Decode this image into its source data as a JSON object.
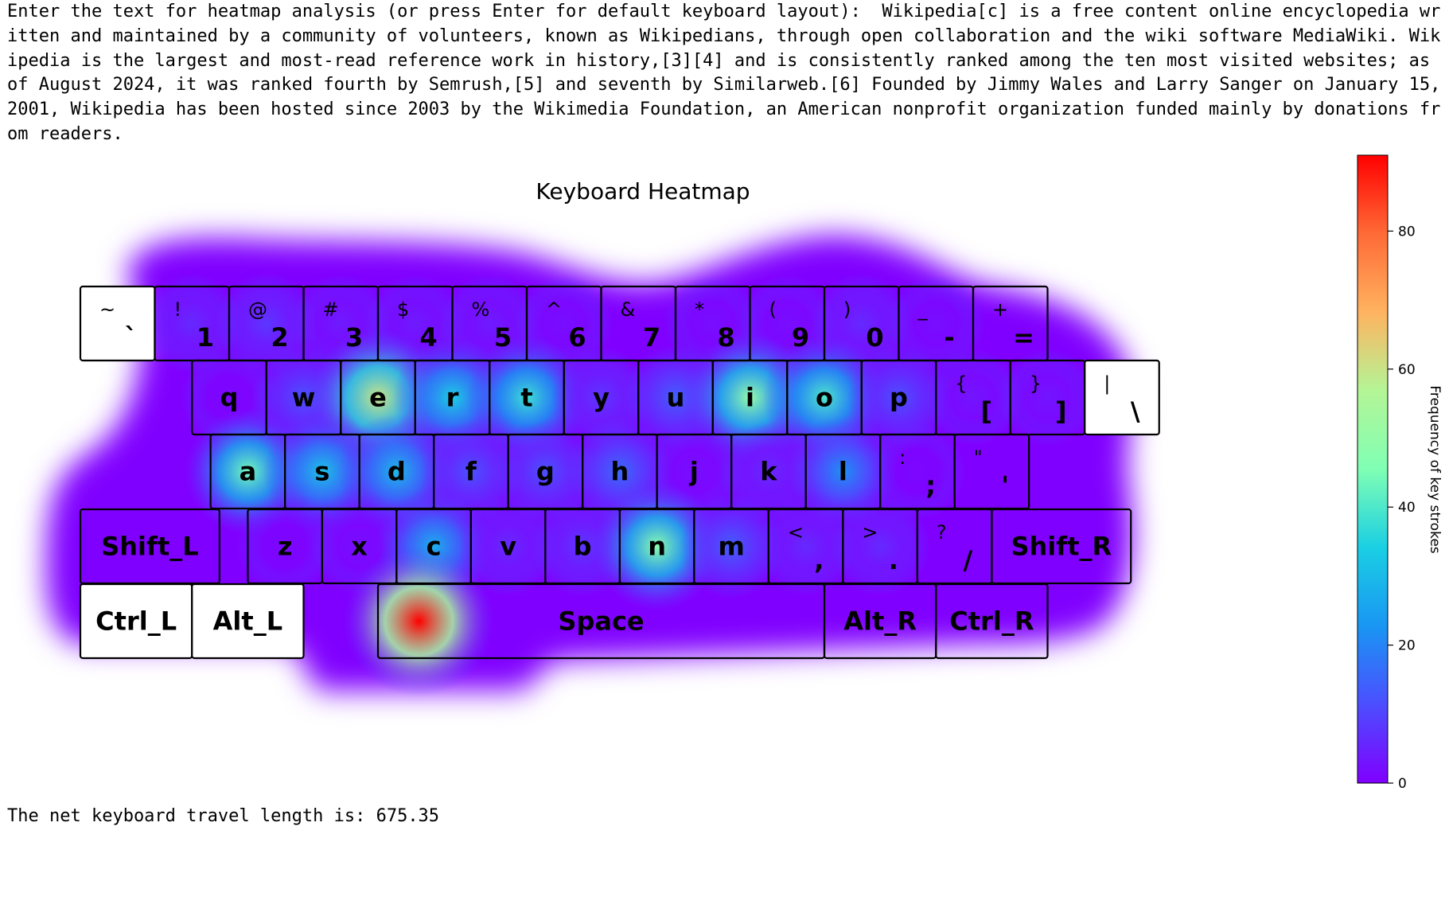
{
  "console": {
    "prompt_line": "Enter the text for heatmap analysis (or press Enter for default keyboard layout):  Wikipedia[c] is a free content online encyclopedia written and maintained by a community of volunteers, known as Wikipedians, through open collaboration and the wiki software MediaWiki. Wikipedia is the largest and most-read reference work in history,[3][4] and is consistently ranked among the ten most visited websites; as of August 2024, it was ranked fourth by Semrush,[5] and seventh by Similarweb.[6] Founded by Jimmy Wales and Larry Sanger on January 15, 2001, Wikipedia has been hosted since 2003 by the Wikimedia Foundation, an American nonprofit organization funded mainly by donations from readers.",
    "result_line": "The net keyboard travel length is: 675.35"
  },
  "chart_data": {
    "type": "heatmap",
    "title": "Keyboard Heatmap",
    "colorbar": {
      "label": "Frequency of key strokes",
      "ticks": [
        0,
        20,
        40,
        60,
        80
      ],
      "range": [
        0,
        91
      ],
      "colormap": "rainbow"
    },
    "keyboard_rows": [
      [
        {
          "top": "~",
          "bottom": "`"
        },
        {
          "top": "!",
          "bottom": "1"
        },
        {
          "top": "@",
          "bottom": "2"
        },
        {
          "top": "#",
          "bottom": "3"
        },
        {
          "top": "$",
          "bottom": "4"
        },
        {
          "top": "%",
          "bottom": "5"
        },
        {
          "top": "^",
          "bottom": "6"
        },
        {
          "top": "&",
          "bottom": "7"
        },
        {
          "top": "*",
          "bottom": "8"
        },
        {
          "top": "(",
          "bottom": "9"
        },
        {
          "top": ")",
          "bottom": "0"
        },
        {
          "top": "_",
          "bottom": "-"
        },
        {
          "top": "+",
          "bottom": "="
        }
      ],
      [
        {
          "label": "q"
        },
        {
          "label": "w"
        },
        {
          "label": "e"
        },
        {
          "label": "r"
        },
        {
          "label": "t"
        },
        {
          "label": "y"
        },
        {
          "label": "u"
        },
        {
          "label": "i"
        },
        {
          "label": "o"
        },
        {
          "label": "p"
        },
        {
          "top": "{",
          "bottom": "["
        },
        {
          "top": "}",
          "bottom": "]"
        },
        {
          "top": "|",
          "bottom": "\\"
        }
      ],
      [
        {
          "label": "a"
        },
        {
          "label": "s"
        },
        {
          "label": "d"
        },
        {
          "label": "f"
        },
        {
          "label": "g"
        },
        {
          "label": "h"
        },
        {
          "label": "j"
        },
        {
          "label": "k"
        },
        {
          "label": "l"
        },
        {
          "top": ":",
          "bottom": ";"
        },
        {
          "top": "\"",
          "bottom": "'"
        }
      ],
      [
        {
          "label": "Shift_L"
        },
        {
          "label": "z"
        },
        {
          "label": "x"
        },
        {
          "label": "c"
        },
        {
          "label": "v"
        },
        {
          "label": "b"
        },
        {
          "label": "n"
        },
        {
          "label": "m"
        },
        {
          "top": "<",
          "bottom": ","
        },
        {
          "top": ">",
          "bottom": "."
        },
        {
          "top": "?",
          "bottom": "/"
        },
        {
          "label": "Shift_R"
        }
      ],
      [
        {
          "label": "Ctrl_L"
        },
        {
          "label": "Alt_L"
        },
        {
          "label": "Space"
        },
        {
          "label": "Alt_R"
        },
        {
          "label": "Ctrl_R"
        }
      ]
    ],
    "key_frequencies": {
      "space": 91,
      "e": 60,
      "i": 50,
      "n": 48,
      "a": 44,
      "o": 40,
      "t": 38,
      "r": 34,
      "s": 32,
      "d": 30,
      "l": 22,
      "c": 28,
      "w": 12,
      "h": 16,
      "m": 14,
      "u": 14,
      "f": 12,
      "g": 12,
      "p": 12,
      "y": 8,
      "b": 8,
      "k": 6,
      "v": 6,
      "2": 8,
      "1": 6,
      "0": 6,
      "3": 4,
      "4": 4,
      "5": 4,
      "6": 2,
      "8": 2,
      "9": 2,
      ".": 6,
      ",": 6,
      "[": 3,
      "]": 3,
      "j": 2,
      "x": 2,
      "z": 1,
      "q": 1,
      "-": 2,
      ";": 1,
      "shift": 10
    }
  }
}
